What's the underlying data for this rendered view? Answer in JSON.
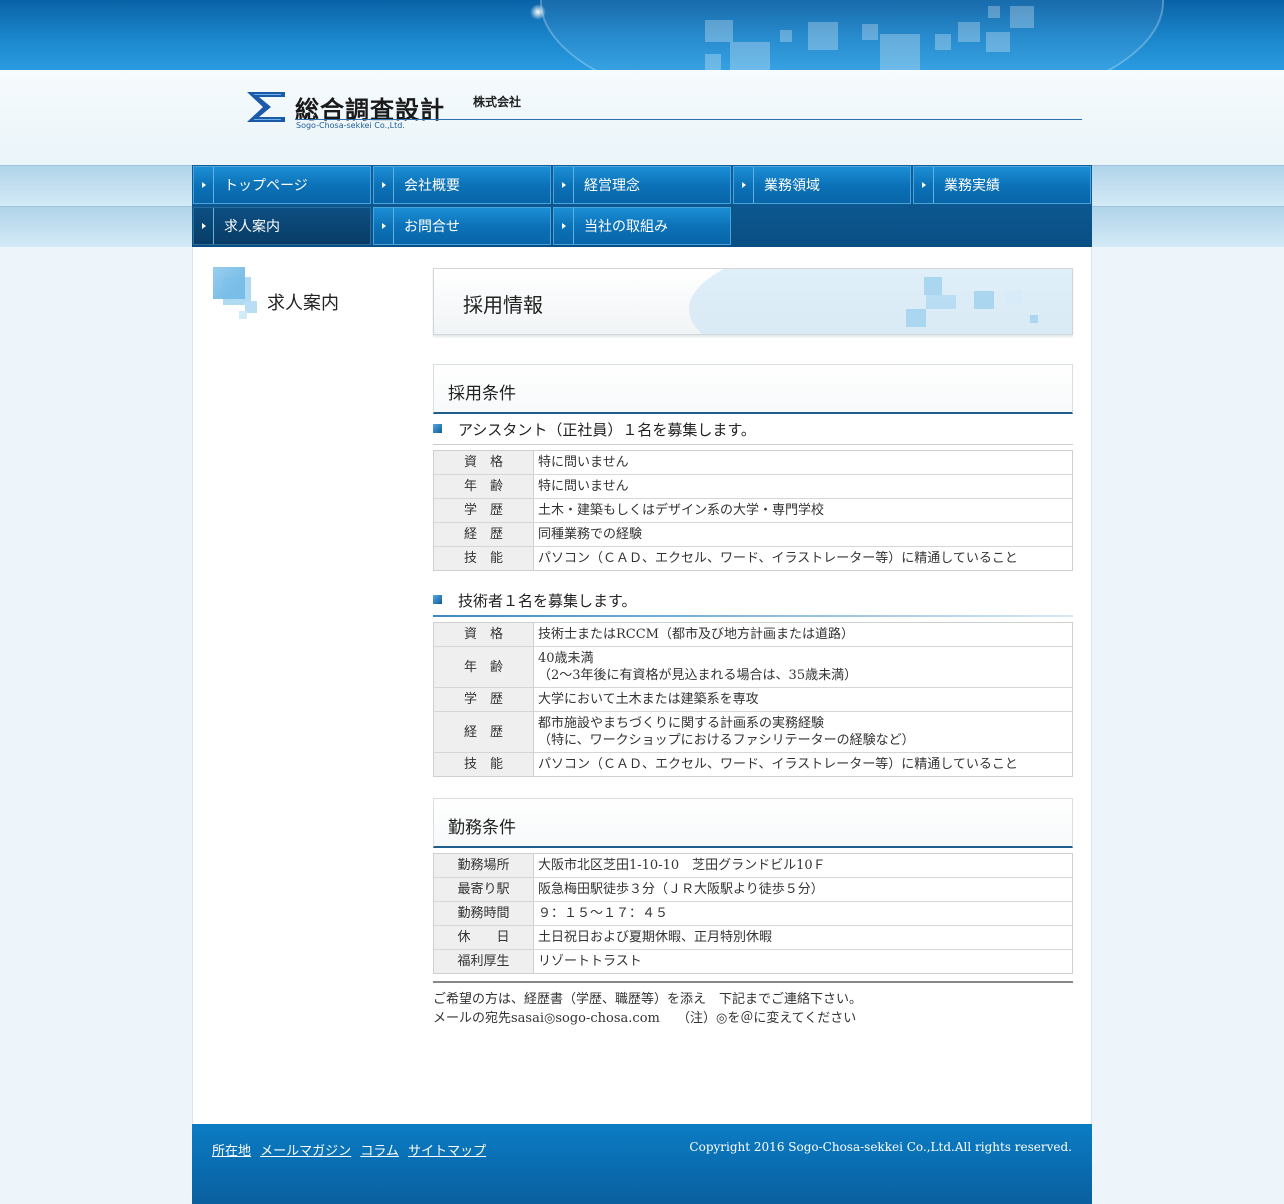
{
  "header": {
    "company_name": "総合調査設計",
    "company_suffix": "株式会社",
    "company_english": "Sogo-Chosa-sekkei Co.,Ltd."
  },
  "nav": {
    "items": [
      {
        "label": "トップページ"
      },
      {
        "label": "会社概要"
      },
      {
        "label": "経営理念"
      },
      {
        "label": "業務領域"
      },
      {
        "label": "業務実績"
      },
      {
        "label": "求人案内"
      },
      {
        "label": "お問合せ"
      },
      {
        "label": "当社の取組み"
      }
    ]
  },
  "sidebar": {
    "title": "求人案内"
  },
  "page": {
    "title": "採用情報"
  },
  "recruit": {
    "heading": "採用条件",
    "assistant": {
      "title": "アシスタント（正社員）１名を募集します。",
      "rows": [
        {
          "k": "資　格",
          "v": "特に問いません"
        },
        {
          "k": "年　齢",
          "v": "特に問いません"
        },
        {
          "k": "学　歴",
          "v": "土木・建築もしくはデザイン系の大学・専門学校"
        },
        {
          "k": "経　歴",
          "v": "同種業務での経験"
        },
        {
          "k": "技　能",
          "v": "パソコン（ＣＡＤ、エクセル、ワード、イラストレーター等）に精通していること"
        }
      ]
    },
    "engineer": {
      "title": "技術者１名を募集します。",
      "rows": [
        {
          "k": "資　格",
          "v": "技術士またはRCCM（都市及び地方計画または道路）",
          "v2": ""
        },
        {
          "k": "年　齢",
          "v": "40歳未満",
          "v2": "（2～3年後に有資格が見込まれる場合は、35歳未満）"
        },
        {
          "k": "学　歴",
          "v": "大学において土木または建築系を専攻",
          "v2": ""
        },
        {
          "k": "経　歴",
          "v": "都市施設やまちづくりに関する計画系の実務経験",
          "v2": "（特に、ワークショップにおけるファシリテーターの経験など）"
        },
        {
          "k": "技　能",
          "v": "パソコン（ＣＡＤ、エクセル、ワード、イラストレーター等）に精通していること",
          "v2": ""
        }
      ]
    }
  },
  "work": {
    "heading": "勤務条件",
    "rows": [
      {
        "k": "勤務場所",
        "v": "大阪市北区芝田1-10-10　芝田グランドビル10Ｆ"
      },
      {
        "k": "最寄り駅",
        "v": "阪急梅田駅徒歩３分（ＪＲ大阪駅より徒歩５分）"
      },
      {
        "k": "勤務時間",
        "v": "９：１５～１７：４５"
      },
      {
        "k": "休　　日",
        "v": "土日祝日および夏期休暇、正月特別休暇"
      },
      {
        "k": "福利厚生",
        "v": "リゾートトラスト"
      }
    ]
  },
  "contact": {
    "line1": "ご希望の方は、経歴書（学歴、職歴等）を添え　下記までご連絡下さい。",
    "line2": "メールの宛先sasai◎sogo-chosa.com　 （注）◎を＠に変えてください"
  },
  "footer": {
    "links": [
      {
        "label": "所在地"
      },
      {
        "label": "メールマガジン"
      },
      {
        "label": "コラム"
      },
      {
        "label": "サイトマップ"
      }
    ],
    "copyright": "Copyright 2016 Sogo-Chosa-sekkei Co.,Ltd.All rights reserved."
  },
  "colors": {
    "brand_blue": "#0c72b8",
    "nav_active": "#0d4f82",
    "footer_blue": "#0a68aa"
  }
}
